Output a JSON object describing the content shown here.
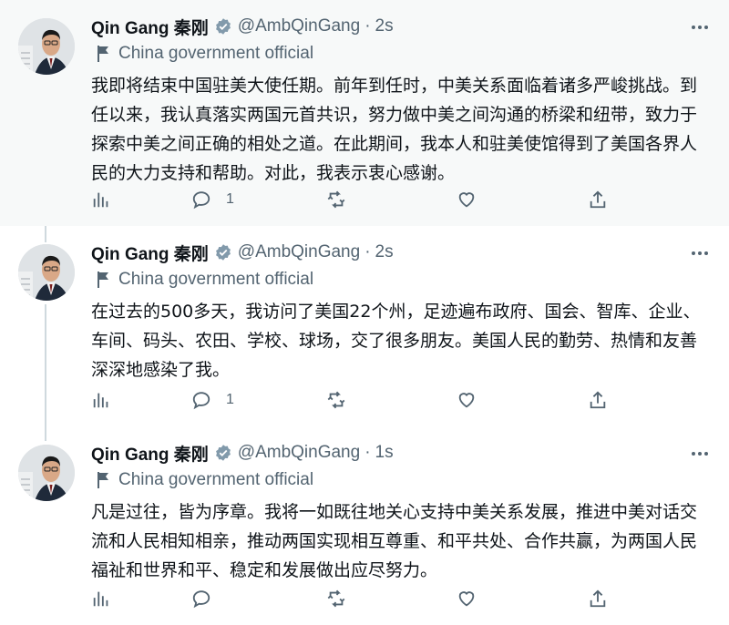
{
  "colors": {
    "accent": "#1d9bf0",
    "muted": "#536471",
    "text": "#0f1419",
    "highlight_bg": "#f7f9f9"
  },
  "tweets": [
    {
      "author": {
        "name": "Qin Gang 秦刚",
        "handle": "@AmbQinGang"
      },
      "separator": "·",
      "time": "2s",
      "label": "China government official",
      "text": "我即将结束中国驻美大使任期。前年到任时，中美关系面临着诸多严峻挑战。到任以来，我认真落实两国元首共识，努力做中美之间沟通的桥梁和纽带，致力于探索中美之间正确的相处之道。在此期间，我本人和驻美使馆得到了美国各界人民的大力支持和帮助。对此，我表示衷心感谢。",
      "reply_count": "1"
    },
    {
      "author": {
        "name": "Qin Gang 秦刚",
        "handle": "@AmbQinGang"
      },
      "separator": "·",
      "time": "2s",
      "label": "China government official",
      "text": "在过去的500多天，我访问了美国22个州，足迹遍布政府、国会、智库、企业、车间、码头、农田、学校、球场，交了很多朋友。美国人民的勤劳、热情和友善深深地感染了我。",
      "reply_count": "1"
    },
    {
      "author": {
        "name": "Qin Gang 秦刚",
        "handle": "@AmbQinGang"
      },
      "separator": "·",
      "time": "1s",
      "label": "China government official",
      "text": "凡是过往，皆为序章。我将一如既往地关心支持中美关系发展，推进中美对话交流和人民相知相亲，推动两国实现相互尊重、和平共处、合作共赢，为两国人民福祉和世界和平、稳定和发展做出应尽努力。",
      "reply_count": ""
    }
  ],
  "icons": [
    "verified-badge-icon",
    "flag-icon",
    "more-icon",
    "views-icon",
    "reply-icon",
    "retweet-icon",
    "like-icon",
    "share-icon"
  ]
}
